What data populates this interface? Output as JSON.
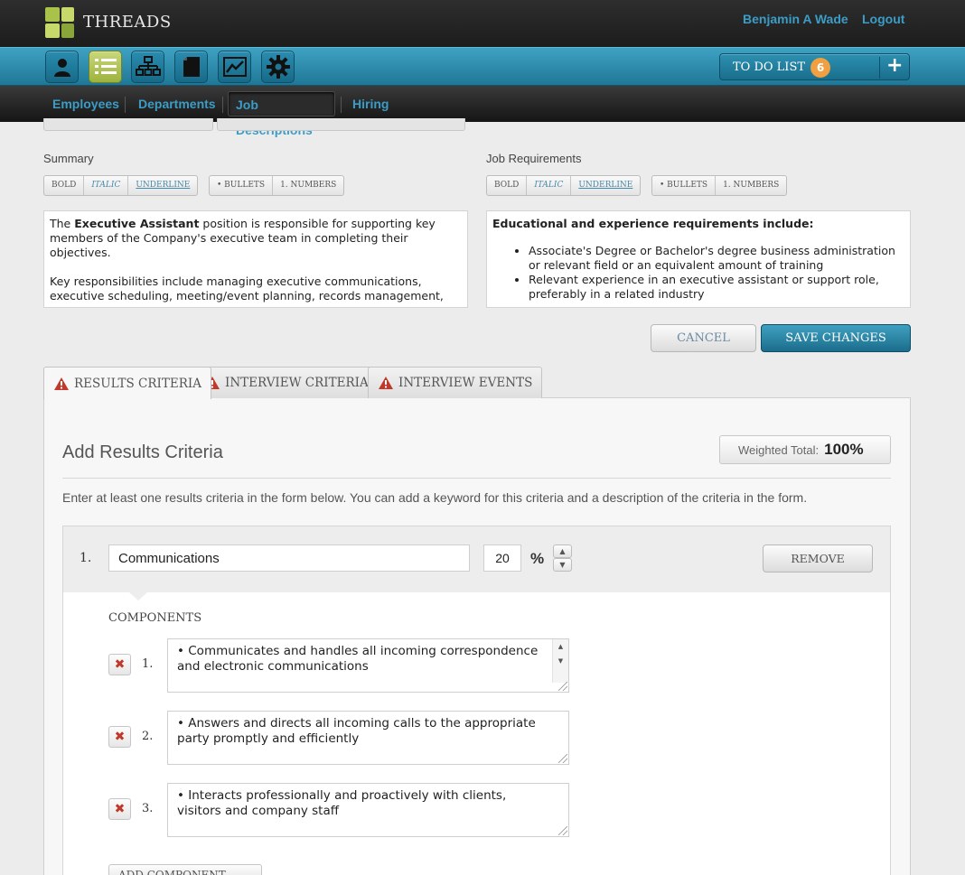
{
  "app": {
    "name": "THREADS",
    "user": "Benjamin A Wade",
    "logout": "Logout",
    "colors": {
      "accent": "#3b9dc6",
      "logo_green": "#a9c24a",
      "badge": "#f0a040",
      "warn": "#c0392b"
    }
  },
  "toolbar": {
    "icons": [
      "user-icon",
      "list-icon",
      "org-chart-icon",
      "document-icon",
      "chart-icon",
      "gear-icon"
    ],
    "todo_label": "TO DO LIST",
    "todo_count": "6",
    "todo_add": "+"
  },
  "subnav": {
    "items": [
      "Employees",
      "Departments",
      "Job Descriptions",
      "Hiring"
    ],
    "active": "Job Descriptions"
  },
  "summary": {
    "label": "Summary",
    "format_buttons": [
      "BOLD",
      "ITALIC",
      "UNDERLINE",
      "• BULLETS",
      "1. NUMBERS"
    ],
    "p1_pre": "The ",
    "p1_bold": "Executive Assistant",
    "p1_post": " position is responsible for supporting key members of the Company's executive team in completing their objectives.",
    "p2": "Key responsibilities include managing executive communications, executive scheduling, meeting/event planning, records management,"
  },
  "requirements": {
    "label": "Job Requirements",
    "format_buttons": [
      "BOLD",
      "ITALIC",
      "UNDERLINE",
      "• BULLETS",
      "1. NUMBERS"
    ],
    "heading": "Educational and experience requirements include:",
    "bullets": [
      "Associate's Degree or Bachelor's degree business administration or relevant field or an equivalent amount of training",
      "Relevant experience in an executive assistant or support role, preferably in a related industry"
    ]
  },
  "actions": {
    "cancel": "CANCEL",
    "save": "SAVE CHANGES"
  },
  "tabs": [
    "RESULTS CRITERIA",
    "INTERVIEW CRITERIA",
    "INTERVIEW EVENTS"
  ],
  "results": {
    "title": "Add Results Criteria",
    "weighted_label": "Weighted Total:",
    "weighted_value": "100%",
    "instructions": "Enter at least one results criteria in the form below. You can add a keyword for this criteria and a description of the criteria in the form.",
    "criteria": {
      "number": "1.",
      "name": "Communications",
      "percent": "20",
      "percent_sign": "%",
      "remove": "REMOVE",
      "components_label": "COMPONENTS",
      "components": [
        {
          "num": "1.",
          "text": "• Communicates and handles all incoming correspondence and electronic communications"
        },
        {
          "num": "2.",
          "text": "• Answers and directs all incoming calls to the appropriate party promptly and efficiently"
        },
        {
          "num": "3.",
          "text": "• Interacts professionally and proactively with clients, visitors and company staff"
        }
      ],
      "add_component": "ADD COMPONENT"
    }
  }
}
